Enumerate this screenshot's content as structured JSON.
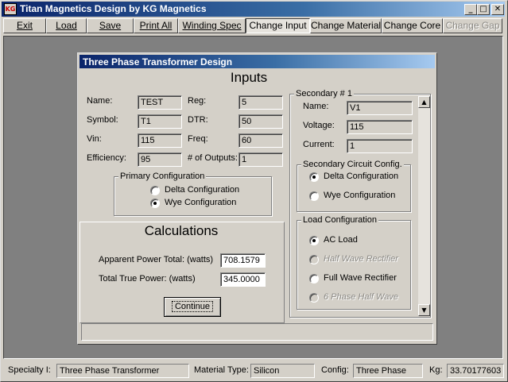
{
  "window": {
    "title": "Titan Magnetics Design by KG Magnetics",
    "icon_text": "KG",
    "buttons": {
      "minimize": "_",
      "maximize": "□",
      "close": "✕"
    }
  },
  "menu": {
    "exit": "Exit",
    "load": "Load",
    "save": "Save",
    "print_all": "Print All",
    "winding_spec": "Winding Spec",
    "change_input": "Change Input",
    "change_material": "Change Material",
    "change_core": "Change Core",
    "change_gap": "Change Gap"
  },
  "dialog": {
    "title": "Three Phase Transformer Design",
    "inputs": {
      "heading": "Inputs",
      "name_label": "Name:",
      "name_value": "TEST",
      "symbol_label": "Symbol:",
      "symbol_value": "T1",
      "vin_label": "Vin:",
      "vin_value": "115",
      "efficiency_label": "Efficiency:",
      "efficiency_value": "95",
      "reg_label": "Reg:",
      "reg_value": "5",
      "dtr_label": "DTR:",
      "dtr_value": "50",
      "freq_label": "Freq:",
      "freq_value": "60",
      "outputs_label": "# of Outputs:",
      "outputs_value": "1"
    },
    "primary": {
      "title": "Primary Configuration",
      "delta": "Delta Configuration",
      "wye": "Wye Configuration",
      "selected": "wye"
    },
    "calculations": {
      "heading": "Calculations",
      "apparent_label": "Apparent Power Total: (watts)",
      "apparent_value": "708.1579",
      "true_label": "Total True Power: (watts)",
      "true_value": "345.0000",
      "continue_label": "Continue"
    },
    "secondary": {
      "title": "Secondary # 1",
      "name_label": "Name:",
      "name_value": "V1",
      "voltage_label": "Voltage:",
      "voltage_value": "115",
      "current_label": "Current:",
      "current_value": "1",
      "circuit": {
        "title": "Secondary Circuit Config.",
        "delta": "Delta Configuration",
        "wye": "Wye Configuration",
        "selected": "delta"
      },
      "load": {
        "title": "Load Configuration",
        "ac": "AC Load",
        "half_wave": "Half Wave Rectifier",
        "full_wave": "Full Wave Rectifier",
        "six_phase": "6 Phase Half Wave",
        "selected": "ac"
      },
      "scroll_up": "▲",
      "scroll_down": "▼"
    }
  },
  "status": {
    "specialty_label": "Specialty I:",
    "specialty_value": "Three Phase Transformer",
    "material_label": "Material Type:",
    "material_value": "Silicon",
    "config_label": "Config:",
    "config_value": "Three Phase",
    "kg_label": "Kg:",
    "kg_value": "33.70177603"
  }
}
